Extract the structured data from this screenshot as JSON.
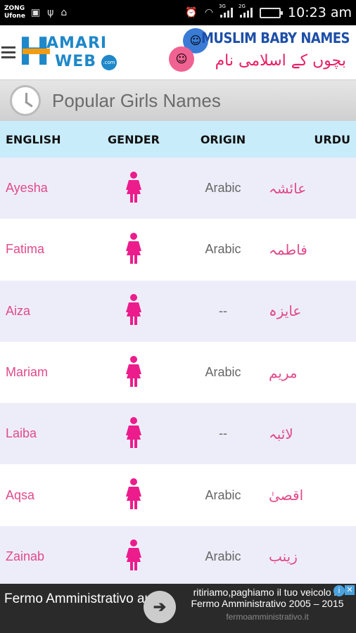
{
  "status_bar": {
    "carrier_1": "ZONG",
    "carrier_2": "Ufone",
    "time": "10:23 am",
    "signal_1_label": "3G",
    "signal_2_label": "2G",
    "icons_left": [
      "image-icon",
      "usb-icon",
      "android-debug-icon"
    ],
    "icons_right": [
      "alarm-icon",
      "wifi-icon",
      "signal-icon",
      "signal-icon",
      "battery-icon"
    ]
  },
  "header": {
    "logo_letter": "H",
    "logo_line1": "AMARI",
    "logo_line2": "WEB",
    "logo_badge": ".com",
    "brand_title": "MUSLIM BABY NAMES",
    "brand_subtitle": "بچوں کے اسلامی نام"
  },
  "section": {
    "title": "Popular Girls Names"
  },
  "table": {
    "columns": [
      "ENGLISH",
      "GENDER",
      "ORIGIN",
      "URDU"
    ],
    "rows": [
      {
        "english": "Ayesha",
        "gender": "female",
        "origin": "Arabic",
        "urdu": "عائشہ"
      },
      {
        "english": "Fatima",
        "gender": "female",
        "origin": "Arabic",
        "urdu": "فاطمہ"
      },
      {
        "english": "Aiza",
        "gender": "female",
        "origin": "--",
        "urdu": "عایزہ"
      },
      {
        "english": "Mariam",
        "gender": "female",
        "origin": "Arabic",
        "urdu": "مریم"
      },
      {
        "english": "Laiba",
        "gender": "female",
        "origin": "--",
        "urdu": "لائبہ"
      },
      {
        "english": "Aqsa",
        "gender": "female",
        "origin": "Arabic",
        "urdu": "اقصیٰ"
      },
      {
        "english": "Zainab",
        "gender": "female",
        "origin": "Arabic",
        "urdu": "زینب"
      }
    ]
  },
  "ad": {
    "headline": "Fermo Amministrativo auto",
    "body": "ritiriamo,paghiamo il tuo veicolo in Fermo Amministrativo 2005 – 2015",
    "url": "fermoamministrativo.it"
  },
  "colors": {
    "name_pink": "#e14a8c",
    "female_icon": "#ec1c8c",
    "header_row": "#c9ecfb",
    "alt_row": "#ededf9"
  }
}
